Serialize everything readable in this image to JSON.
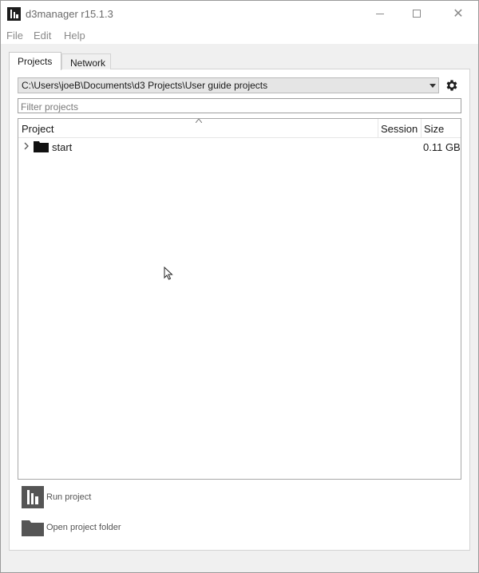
{
  "window": {
    "title": "d3manager  r15.1.3",
    "logo_icon": "d3-logo-icon",
    "minimize_icon": "minimize-icon",
    "maximize_icon": "maximize-icon",
    "close_icon": "close-icon",
    "close_glyph": "✕"
  },
  "menu": {
    "items": [
      {
        "label": "File"
      },
      {
        "label": "Edit"
      },
      {
        "label": "Help"
      }
    ]
  },
  "tabs": [
    {
      "label": "Projects",
      "active": true
    },
    {
      "label": "Network",
      "active": false
    }
  ],
  "path_selector": {
    "value": "C:\\Users\\joeB\\Documents\\d3 Projects\\User guide projects",
    "settings_icon": "gear-icon"
  },
  "filter": {
    "placeholder": "Filter projects",
    "value": ""
  },
  "table": {
    "columns": [
      "Project",
      "Session",
      "Size"
    ],
    "sort_column": "Project",
    "rows": [
      {
        "name": "start",
        "session": "",
        "size": "0.11 GB",
        "icon": "folder-icon",
        "expand_icon": "chevron-right-icon"
      }
    ]
  },
  "actions": {
    "run_label": "Run project",
    "run_icon": "d3-logo-icon",
    "open_folder_label": "Open project folder",
    "open_folder_icon": "folder-icon"
  },
  "colors": {
    "background": "#f0f0f0",
    "panel": "#ffffff",
    "selector_bg": "#e5e5e5",
    "disabled_text": "#555555"
  }
}
